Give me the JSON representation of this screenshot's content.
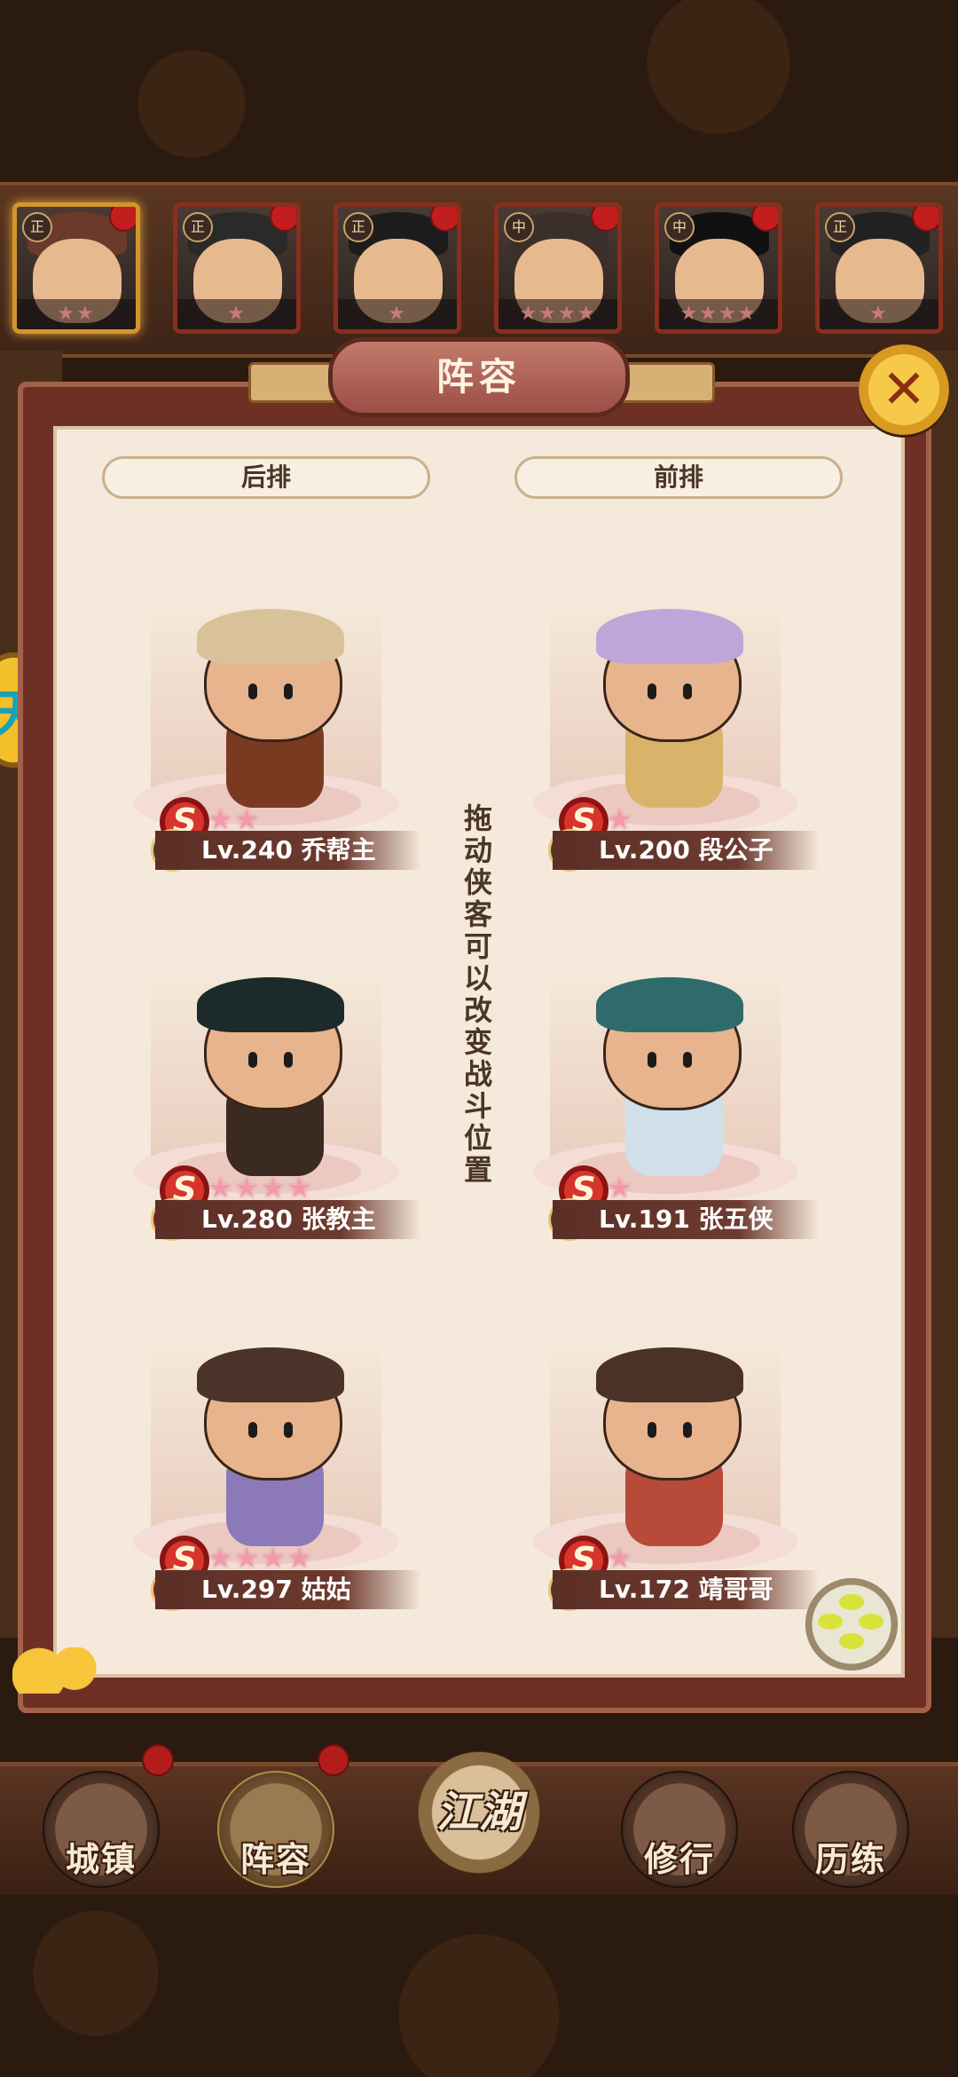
{
  "panel": {
    "title": "阵容",
    "close_icon": "close-icon",
    "back_row_label": "后排",
    "front_row_label": "前排",
    "hint": "拖动侠客可以改变战斗位置"
  },
  "top_heroes": [
    {
      "tag": "正",
      "stars": "★★",
      "selected": true
    },
    {
      "tag": "正",
      "stars": "★",
      "selected": false
    },
    {
      "tag": "正",
      "stars": "★",
      "selected": false
    },
    {
      "tag": "中",
      "stars": "★★★★",
      "selected": false
    },
    {
      "tag": "中",
      "stars": "★★★★",
      "selected": false
    },
    {
      "tag": "正",
      "stars": "★",
      "selected": false
    }
  ],
  "formation": {
    "back": [
      {
        "camp": "正",
        "grade": "S",
        "stars": "★★",
        "level": "Lv.240",
        "name": "乔帮主"
      },
      {
        "camp": "中",
        "grade": "S",
        "stars": "★★★★",
        "level": "Lv.280",
        "name": "张教主"
      },
      {
        "camp": "中",
        "grade": "S",
        "stars": "★★★★",
        "level": "Lv.297",
        "name": "姑姑"
      }
    ],
    "front": [
      {
        "camp": "正",
        "grade": "S",
        "stars": "★",
        "level": "Lv.200",
        "name": "段公子"
      },
      {
        "camp": "正",
        "grade": "S",
        "stars": "★",
        "level": "Lv.191",
        "name": "张五侠"
      },
      {
        "camp": "正",
        "grade": "S",
        "stars": "★",
        "level": "Lv.172",
        "name": "靖哥哥"
      }
    ]
  },
  "labels": {
    "back_0": "Lv.240 乔帮主",
    "back_1": "Lv.280 张教主",
    "back_2": "Lv.297 姑姑",
    "front_0": "Lv.200 段公子",
    "front_1": "Lv.191 张五侠",
    "front_2": "Lv.172 靖哥哥"
  },
  "left_badge": "天",
  "bottom_nav": {
    "town": "城镇",
    "lineup": "阵容",
    "jianghu": "江湖",
    "practice": "修行",
    "training": "历练"
  },
  "colors": {
    "panel_bg": "#f4e9da",
    "frame": "#6e2f25",
    "accent_gold": "#f7c948",
    "star_pink": "#f29aa8"
  }
}
